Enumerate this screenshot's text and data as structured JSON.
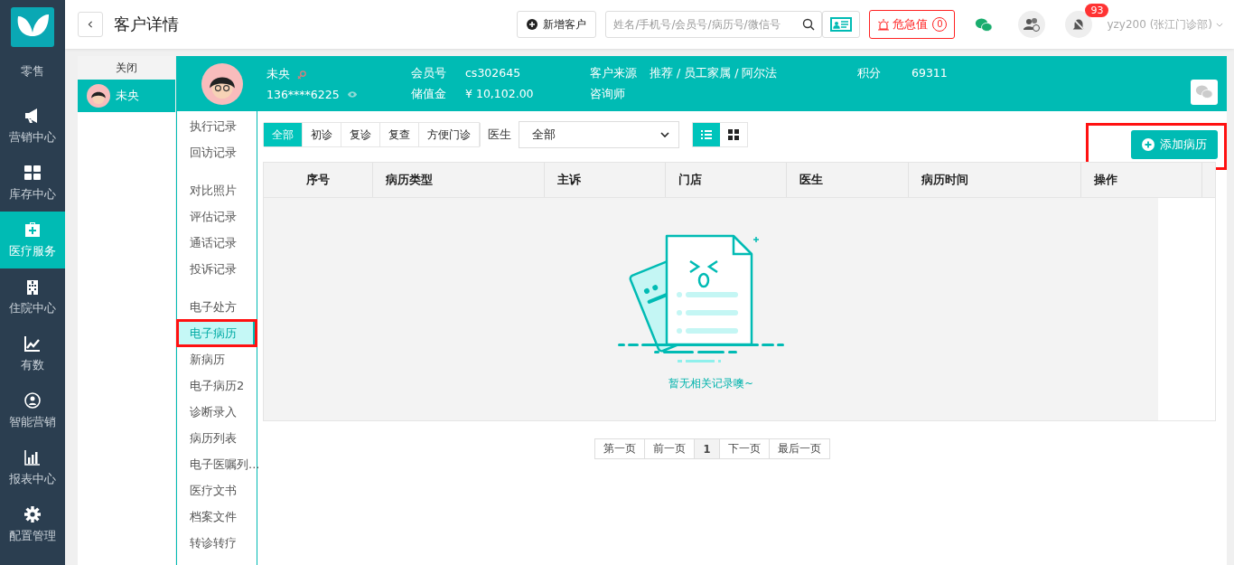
{
  "nav": {
    "items": [
      {
        "label": "零售",
        "selected": false
      },
      {
        "label": "营销中心",
        "selected": false
      },
      {
        "label": "库存中心",
        "selected": false
      },
      {
        "label": "医疗服务",
        "selected": true
      },
      {
        "label": "住院中心",
        "selected": false
      },
      {
        "label": "有数",
        "selected": false
      },
      {
        "label": "智能营销",
        "selected": false
      },
      {
        "label": "报表中心",
        "selected": false
      },
      {
        "label": "配置管理",
        "selected": false
      }
    ]
  },
  "header": {
    "title": "客户详情",
    "new_customer": "新增客户",
    "search": {
      "placeholder": "姓名/手机号/会员号/病历号/微信号"
    },
    "critical": {
      "label": "危急值",
      "count": "0"
    },
    "notification_count": "93",
    "user": "yzy200 (张江门诊部)"
  },
  "customer_tabs": {
    "close": "关闭",
    "tabs": [
      {
        "name": "未央",
        "selected": true
      }
    ]
  },
  "customer": {
    "name": "未央",
    "phone": "136****6225",
    "fields": [
      {
        "label": "会员号",
        "value": "cs302645"
      },
      {
        "label": "储值金",
        "value": "¥ 10,102.00"
      },
      {
        "label": "客户来源",
        "value": "推荐 / 员工家属 / 阿尔法"
      },
      {
        "label": "咨询师"
      },
      {
        "label": "积分",
        "value": "69311"
      }
    ]
  },
  "side_menu": {
    "groups": [
      [
        {
          "label": "执行记录",
          "selected": false,
          "annotated": false
        },
        {
          "label": "回访记录",
          "selected": false,
          "annotated": false
        }
      ],
      [
        {
          "label": "对比照片",
          "selected": false,
          "annotated": false
        },
        {
          "label": "评估记录",
          "selected": false,
          "annotated": false
        },
        {
          "label": "通话记录",
          "selected": false,
          "annotated": false
        },
        {
          "label": "投诉记录",
          "selected": false,
          "annotated": false
        }
      ],
      [
        {
          "label": "电子处方",
          "selected": false,
          "annotated": false
        },
        {
          "label": "电子病历",
          "selected": true,
          "annotated": true
        },
        {
          "label": "新病历",
          "selected": false,
          "annotated": false
        },
        {
          "label": "电子病历2",
          "selected": false,
          "annotated": false
        },
        {
          "label": "诊断录入",
          "selected": false,
          "annotated": false
        },
        {
          "label": "病历列表",
          "selected": false,
          "annotated": false
        },
        {
          "label": "电子医嘱列...",
          "selected": false,
          "annotated": false
        },
        {
          "label": "医疗文书",
          "selected": false,
          "annotated": false
        },
        {
          "label": "档案文件",
          "selected": false,
          "annotated": false
        },
        {
          "label": "转诊转疗",
          "selected": false,
          "annotated": false
        }
      ]
    ]
  },
  "filters": {
    "types": [
      {
        "label": "全部",
        "selected": true
      },
      {
        "label": "初诊",
        "selected": false
      },
      {
        "label": "复诊",
        "selected": false
      },
      {
        "label": "复查",
        "selected": false
      },
      {
        "label": "方便门诊",
        "selected": false
      }
    ],
    "doctor_label": "医生",
    "doctor_value": "全部",
    "views": [
      {
        "kind": "list",
        "selected": true
      },
      {
        "kind": "grid",
        "selected": false
      }
    ]
  },
  "add_button": {
    "label": "添加病历",
    "annotated": true
  },
  "table": {
    "columns": [
      "序号",
      "病历类型",
      "主诉",
      "门店",
      "医生",
      "病历时间",
      "操作"
    ],
    "empty_text": "暂无相关记录噢~"
  },
  "pagination": [
    {
      "label": "第一页",
      "selected": false
    },
    {
      "label": "前一页",
      "selected": false
    },
    {
      "label": "1",
      "selected": true
    },
    {
      "label": "下一页",
      "selected": false
    },
    {
      "label": "最后一页",
      "selected": false
    }
  ]
}
